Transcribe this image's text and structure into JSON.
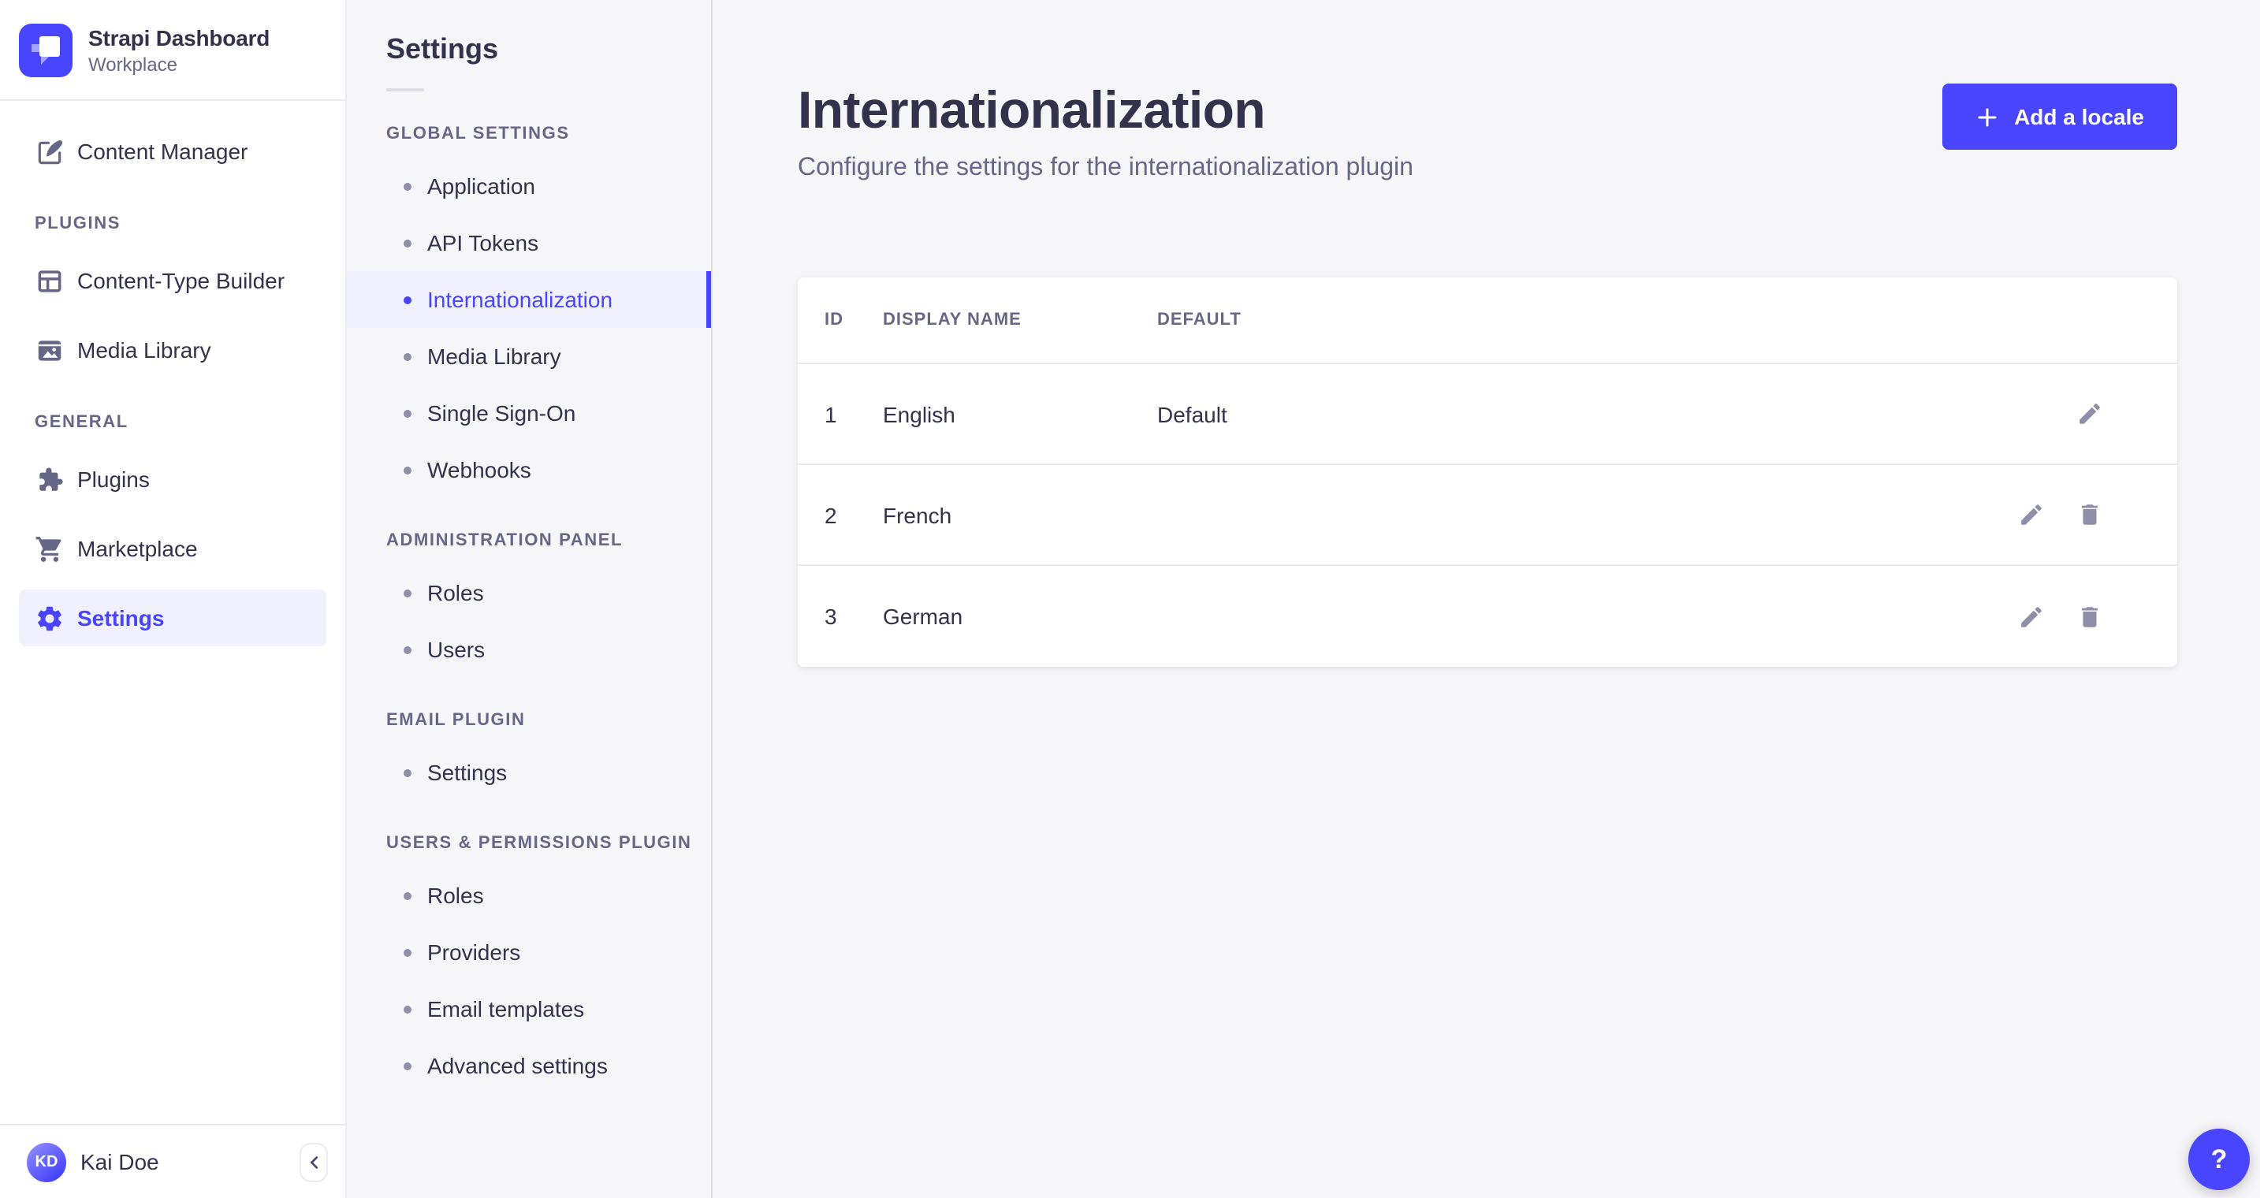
{
  "colors": {
    "primary": "#4945ff",
    "primary_light_bg": "#f0f0ff",
    "text_dark": "#32324d",
    "text_muted": "#666687",
    "icon_gray": "#8e8ea9",
    "border": "#eaeaef",
    "panel_bg": "#f6f6f9"
  },
  "brand": {
    "logo_icon": "strapi-logo",
    "title": "Strapi Dashboard",
    "workspace": "Workplace"
  },
  "sidebar": {
    "top_item": {
      "label": "Content Manager",
      "icon": "pen-icon"
    },
    "sections": [
      {
        "title": "PLUGINS",
        "items": [
          {
            "label": "Content-Type Builder",
            "icon": "layout-icon"
          },
          {
            "label": "Media Library",
            "icon": "image-icon"
          }
        ]
      },
      {
        "title": "GENERAL",
        "items": [
          {
            "label": "Plugins",
            "icon": "puzzle-icon"
          },
          {
            "label": "Marketplace",
            "icon": "cart-icon"
          },
          {
            "label": "Settings",
            "icon": "gear-icon",
            "active": true
          }
        ]
      }
    ],
    "user": {
      "initials": "KD",
      "name": "Kai Doe"
    },
    "collapse_button_icon": "chevron-left-icon"
  },
  "subnav": {
    "title": "Settings",
    "sections": [
      {
        "title": "GLOBAL SETTINGS",
        "items": [
          "Application",
          "API Tokens",
          "Internationalization",
          "Media Library",
          "Single Sign-On",
          "Webhooks"
        ],
        "active_item": "Internationalization"
      },
      {
        "title": "ADMINISTRATION PANEL",
        "items": [
          "Roles",
          "Users"
        ]
      },
      {
        "title": "EMAIL PLUGIN",
        "items": [
          "Settings"
        ]
      },
      {
        "title": "USERS & PERMISSIONS PLUGIN",
        "items": [
          "Roles",
          "Providers",
          "Email templates",
          "Advanced settings"
        ]
      }
    ]
  },
  "page": {
    "title": "Internationalization",
    "subtitle": "Configure the settings for the internationalization plugin",
    "add_locale_button": {
      "icon": "plus-icon",
      "label": "Add a locale"
    }
  },
  "locales_table": {
    "headers": {
      "id": "ID",
      "display_name": "DISPLAY NAME",
      "default": "DEFAULT"
    },
    "rows": [
      {
        "id": "1",
        "display_name": "English",
        "default": "Default",
        "actions": [
          "edit"
        ]
      },
      {
        "id": "2",
        "display_name": "French",
        "default": "",
        "actions": [
          "edit",
          "delete"
        ]
      },
      {
        "id": "3",
        "display_name": "German",
        "default": "",
        "actions": [
          "edit",
          "delete"
        ]
      }
    ]
  },
  "help_button": {
    "label": "?"
  }
}
